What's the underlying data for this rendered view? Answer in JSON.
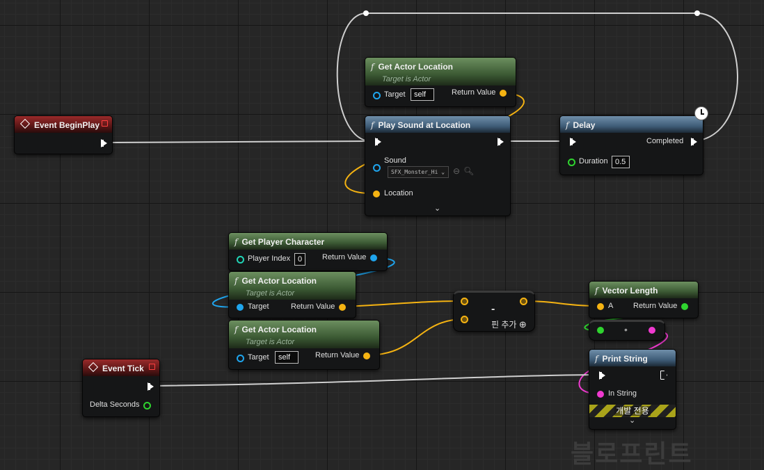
{
  "nodes": {
    "begin_play": {
      "title": "Event BeginPlay"
    },
    "get_actor_location_1": {
      "title": "Get Actor Location",
      "subtitle": "Target is Actor",
      "target_label": "Target",
      "target_value": "self",
      "return_label": "Return Value"
    },
    "play_sound": {
      "title": "Play Sound at Location",
      "sound_label": "Sound",
      "sound_value": "SFX_Monster_Hi",
      "location_label": "Location"
    },
    "delay": {
      "title": "Delay",
      "completed_label": "Completed",
      "duration_label": "Duration",
      "duration_value": "0.5"
    },
    "get_player_character": {
      "title": "Get Player Character",
      "player_index_label": "Player Index",
      "player_index_value": "0",
      "return_label": "Return Value"
    },
    "get_actor_location_2": {
      "title": "Get Actor Location",
      "subtitle": "Target is Actor",
      "target_label": "Target",
      "return_label": "Return Value"
    },
    "get_actor_location_3": {
      "title": "Get Actor Location",
      "subtitle": "Target is Actor",
      "target_label": "Target",
      "target_value": "self",
      "return_label": "Return Value"
    },
    "subtract": {
      "symbol": "-",
      "add_pin_label": "핀 추가"
    },
    "vector_length": {
      "title": "Vector Length",
      "a_label": "A",
      "return_label": "Return Value"
    },
    "event_tick": {
      "title": "Event Tick",
      "delta_label": "Delta Seconds"
    },
    "print_string": {
      "title": "Print String",
      "in_string_label": "In String",
      "dev_only_label": "개발 전용"
    },
    "conversion": {
      "symbol": "•"
    }
  },
  "watermark": "블로프린트",
  "colors": {
    "exec": "#ffffff",
    "vector": "#f5b312",
    "object": "#1fa5ee",
    "float": "#2fd42f",
    "string": "#f03ad0",
    "int": "#21d4b6"
  }
}
